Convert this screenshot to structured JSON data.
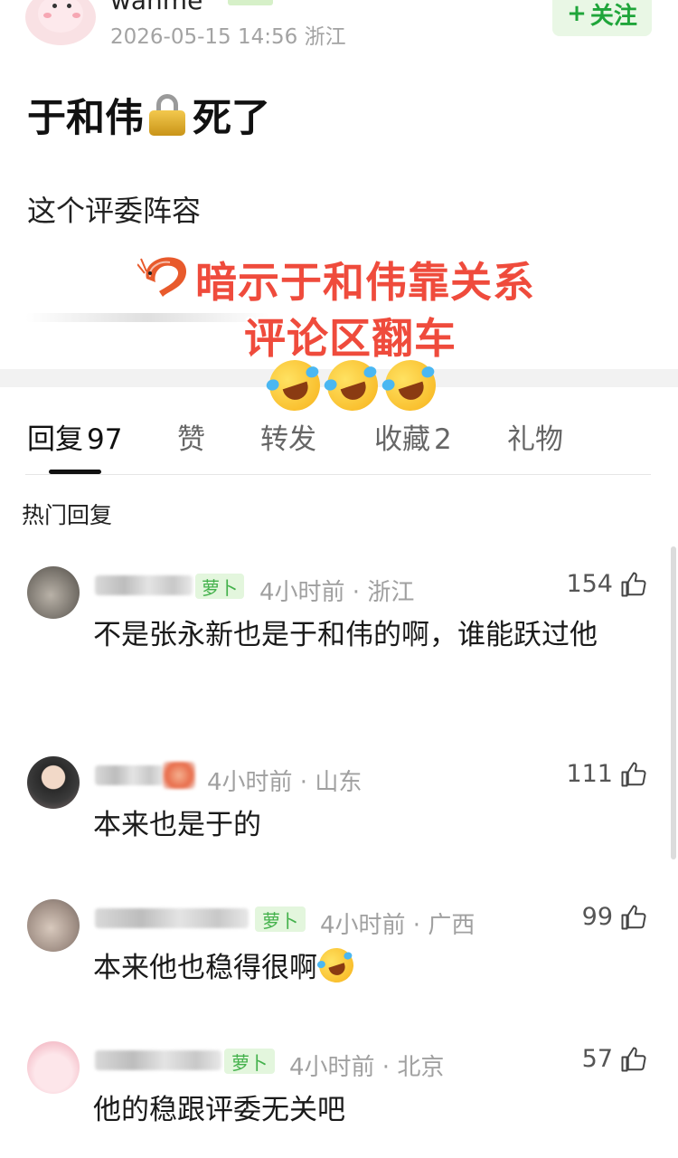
{
  "post": {
    "author_name": "wanme",
    "meta": "2026-05-15 14:56 浙江",
    "follow_label": "关注",
    "title_part1": "于和伟",
    "title_part2": "死了",
    "body": "这个评委阵容"
  },
  "overlay": {
    "line1": "暗示于和伟靠关系",
    "line2": "评论区翻车"
  },
  "tabs": [
    {
      "label": "回复",
      "count": "97"
    },
    {
      "label": "赞",
      "count": ""
    },
    {
      "label": "转发",
      "count": ""
    },
    {
      "label": "收藏",
      "count": "2"
    },
    {
      "label": "礼物",
      "count": ""
    }
  ],
  "section_label": "热门回复",
  "comments": [
    {
      "badge": "萝卜",
      "meta": "4小时前 · 浙江",
      "likes": "154",
      "text": "不是张永新也是于和伟的啊，谁能跃过他"
    },
    {
      "badge": "",
      "meta": "4小时前 · 山东",
      "likes": "111",
      "text": "本来也是于的"
    },
    {
      "badge": "萝卜",
      "meta": "4小时前 · 广西",
      "likes": "99",
      "text": "本来他也稳得很啊"
    },
    {
      "badge": "萝卜",
      "meta": "4小时前 · 北京",
      "likes": "57",
      "text": "他的稳跟评委无关吧"
    }
  ],
  "colors": {
    "accent_green": "#1fa53a",
    "overlay_red": "#ef4b3c",
    "meta_gray": "#a0a0a0"
  },
  "icons": [
    "lock-icon",
    "shrimp-icon",
    "laughing-tears-emoji",
    "thumbs-up-icon",
    "plus-icon"
  ]
}
